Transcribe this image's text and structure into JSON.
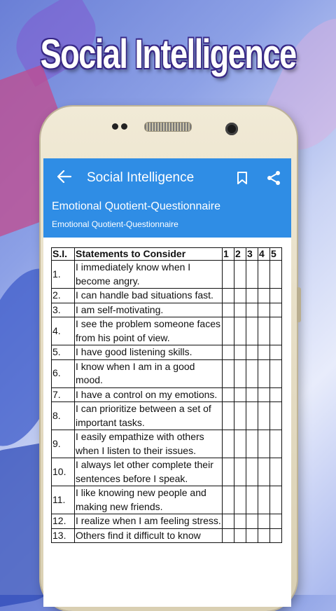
{
  "banner": {
    "title": "Social Intelligence"
  },
  "appbar": {
    "title": "Social Intelligence",
    "back_icon": "arrow-back-icon",
    "bookmark_icon": "bookmark-icon",
    "share_icon": "share-icon"
  },
  "subheader": {
    "title": "Emotional Quotient-Questionnaire",
    "caption": "Emotional Quotient-Questionnaire"
  },
  "table": {
    "headers": {
      "sl": "S.I.",
      "statement": "Statements to Consider",
      "c1": "1",
      "c2": "2",
      "c3": "3",
      "c4": "4",
      "c5": "5"
    },
    "rows": [
      {
        "sl": "1.",
        "text": "I immediately know when I become angry."
      },
      {
        "sl": "2.",
        "text": "I can handle bad situations fast."
      },
      {
        "sl": "3.",
        "text": "I am self-motivating."
      },
      {
        "sl": "4.",
        "text": "I see the problem someone faces from his point of view."
      },
      {
        "sl": "5.",
        "text": "I have good listening skills."
      },
      {
        "sl": "6.",
        "text": "I know when I am in a good mood."
      },
      {
        "sl": "7.",
        "text": "I have a control on my emotions."
      },
      {
        "sl": "8.",
        "text": "I can prioritize between a set of important tasks."
      },
      {
        "sl": "9.",
        "text": "I easily empathize with others when I listen to their issues."
      },
      {
        "sl": "10.",
        "text": "I always let other complete their sentences before I speak."
      },
      {
        "sl": "11.",
        "text": "I like knowing new people and making new friends."
      },
      {
        "sl": "12.",
        "text": "I realize when I am feeling stress."
      },
      {
        "sl": "13.",
        "text": "Others find it difficult to know"
      }
    ]
  },
  "colors": {
    "appbar": "#2f8de5",
    "phone_body": "#e8e0c6"
  }
}
